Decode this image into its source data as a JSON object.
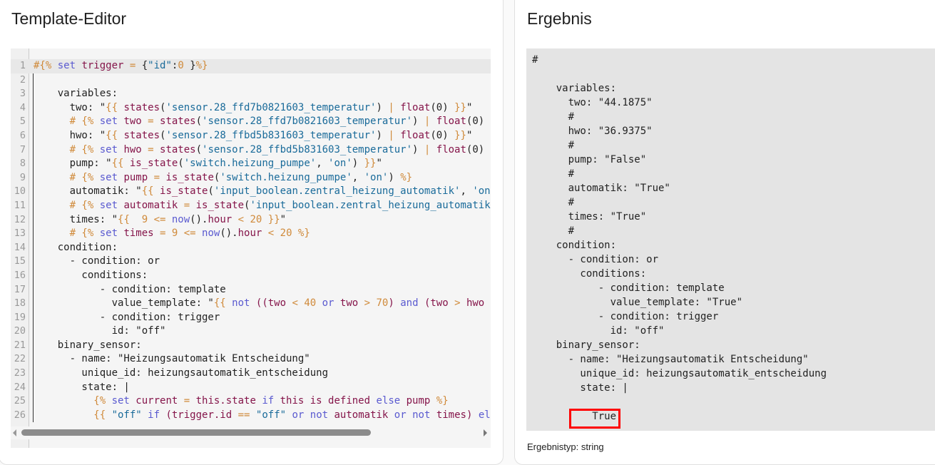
{
  "editor": {
    "title": "Template-Editor",
    "lines": [
      [
        [
          "o",
          "#{% "
        ],
        [
          "k",
          "set "
        ],
        [
          "v",
          "trigger "
        ],
        [
          "o",
          "= "
        ],
        [
          "d",
          "{"
        ],
        [
          "s",
          "\"id\""
        ],
        [
          "d",
          ":"
        ],
        [
          "o",
          "0 "
        ],
        [
          "d",
          "}"
        ],
        [
          "o",
          "%}"
        ]
      ],
      [],
      [
        [
          "d",
          "    variables:"
        ]
      ],
      [
        [
          "d",
          "      two: \""
        ],
        [
          "o",
          "{{ "
        ],
        [
          "v",
          "states"
        ],
        [
          "d",
          "("
        ],
        [
          "s",
          "'sensor.28_ffd7b0821603_temperatur'"
        ],
        [
          "d",
          ") "
        ],
        [
          "o",
          "| "
        ],
        [
          "v",
          "float"
        ],
        [
          "d",
          "(0) "
        ],
        [
          "o",
          "}}"
        ],
        [
          "d",
          "\""
        ]
      ],
      [
        [
          "o",
          "      # {% "
        ],
        [
          "k",
          "set "
        ],
        [
          "v",
          "two "
        ],
        [
          "o",
          "= "
        ],
        [
          "v",
          "states"
        ],
        [
          "d",
          "("
        ],
        [
          "s",
          "'sensor.28_ffd7b0821603_temperatur'"
        ],
        [
          "d",
          ") "
        ],
        [
          "o",
          "| "
        ],
        [
          "v",
          "float"
        ],
        [
          "d",
          "(0)"
        ]
      ],
      [
        [
          "d",
          "      hwo: \""
        ],
        [
          "o",
          "{{ "
        ],
        [
          "v",
          "states"
        ],
        [
          "d",
          "("
        ],
        [
          "s",
          "'sensor.28_ffbd5b831603_temperatur'"
        ],
        [
          "d",
          ") "
        ],
        [
          "o",
          "| "
        ],
        [
          "v",
          "float"
        ],
        [
          "d",
          "(0) "
        ],
        [
          "o",
          "}}"
        ],
        [
          "d",
          "\""
        ]
      ],
      [
        [
          "o",
          "      # {% "
        ],
        [
          "k",
          "set "
        ],
        [
          "v",
          "hwo "
        ],
        [
          "o",
          "= "
        ],
        [
          "v",
          "states"
        ],
        [
          "d",
          "("
        ],
        [
          "s",
          "'sensor.28_ffbd5b831603_temperatur'"
        ],
        [
          "d",
          ") "
        ],
        [
          "o",
          "| "
        ],
        [
          "v",
          "float"
        ],
        [
          "d",
          "(0)"
        ]
      ],
      [
        [
          "d",
          "      pump: \""
        ],
        [
          "o",
          "{{ "
        ],
        [
          "v",
          "is_state"
        ],
        [
          "d",
          "("
        ],
        [
          "s",
          "'switch.heizung_pumpe'"
        ],
        [
          "d",
          ", "
        ],
        [
          "s",
          "'on'"
        ],
        [
          "d",
          ") "
        ],
        [
          "o",
          "}}"
        ],
        [
          "d",
          "\""
        ]
      ],
      [
        [
          "o",
          "      # {% "
        ],
        [
          "k",
          "set "
        ],
        [
          "v",
          "pump "
        ],
        [
          "o",
          "= "
        ],
        [
          "v",
          "is_state"
        ],
        [
          "d",
          "("
        ],
        [
          "s",
          "'switch.heizung_pumpe'"
        ],
        [
          "d",
          ", "
        ],
        [
          "s",
          "'on'"
        ],
        [
          "d",
          ") "
        ],
        [
          "o",
          "%}"
        ]
      ],
      [
        [
          "d",
          "      automatik: \""
        ],
        [
          "o",
          "{{ "
        ],
        [
          "v",
          "is_state"
        ],
        [
          "d",
          "("
        ],
        [
          "s",
          "'input_boolean.zentral_heizung_automatik'"
        ],
        [
          "d",
          ", "
        ],
        [
          "s",
          "'on"
        ]
      ],
      [
        [
          "o",
          "      # {% "
        ],
        [
          "k",
          "set "
        ],
        [
          "v",
          "automatik "
        ],
        [
          "o",
          "= "
        ],
        [
          "v",
          "is_state"
        ],
        [
          "d",
          "("
        ],
        [
          "s",
          "'input_boolean.zentral_heizung_automatik"
        ]
      ],
      [
        [
          "d",
          "      times: \""
        ],
        [
          "o",
          "{{  9 <= "
        ],
        [
          "k",
          "now"
        ],
        [
          "d",
          "()."
        ],
        [
          "v",
          "hour "
        ],
        [
          "o",
          "< 20 }}"
        ],
        [
          "d",
          "\""
        ]
      ],
      [
        [
          "o",
          "      # {% "
        ],
        [
          "k",
          "set "
        ],
        [
          "v",
          "times "
        ],
        [
          "o",
          "= 9 <= "
        ],
        [
          "k",
          "now"
        ],
        [
          "d",
          "()."
        ],
        [
          "v",
          "hour "
        ],
        [
          "o",
          "< 20 %}"
        ]
      ],
      [
        [
          "d",
          "    condition:"
        ]
      ],
      [
        [
          "d",
          "      - condition: or"
        ]
      ],
      [
        [
          "d",
          "        conditions:"
        ]
      ],
      [
        [
          "d",
          "           - condition: template"
        ]
      ],
      [
        [
          "d",
          "             value_template: \""
        ],
        [
          "o",
          "{{ "
        ],
        [
          "k",
          "not "
        ],
        [
          "v",
          "(("
        ],
        [
          "v",
          "two "
        ],
        [
          "o",
          "< 40 "
        ],
        [
          "k",
          "or "
        ],
        [
          "v",
          "two "
        ],
        [
          "o",
          "> 70"
        ],
        [
          "v",
          ") "
        ],
        [
          "k",
          "and "
        ],
        [
          "v",
          "(two "
        ],
        [
          "o",
          "> "
        ],
        [
          "v",
          "hwo "
        ]
      ],
      [
        [
          "d",
          "           - condition: trigger"
        ]
      ],
      [
        [
          "d",
          "             id: \"off\""
        ]
      ],
      [
        [
          "d",
          "    binary_sensor:"
        ]
      ],
      [
        [
          "d",
          "      - name: \"Heizungsautomatik Entscheidung\""
        ]
      ],
      [
        [
          "d",
          "        unique_id: heizungsautomatik_entscheidung"
        ]
      ],
      [
        [
          "d",
          "        state: |"
        ]
      ],
      [
        [
          "o",
          "          {% "
        ],
        [
          "k",
          "set "
        ],
        [
          "v",
          "current "
        ],
        [
          "o",
          "= "
        ],
        [
          "v",
          "this.state "
        ],
        [
          "k",
          "if "
        ],
        [
          "v",
          "this is defined "
        ],
        [
          "k",
          "else "
        ],
        [
          "v",
          "pump "
        ],
        [
          "o",
          "%}"
        ]
      ],
      [
        [
          "o",
          "          {{ "
        ],
        [
          "s",
          "\"off\" "
        ],
        [
          "k",
          "if "
        ],
        [
          "v",
          "(trigger.id "
        ],
        [
          "o",
          "== "
        ],
        [
          "s",
          "\"off\" "
        ],
        [
          "k",
          "or not "
        ],
        [
          "v",
          "automatik "
        ],
        [
          "k",
          "or not "
        ],
        [
          "v",
          "times) "
        ],
        [
          "k",
          "el"
        ]
      ]
    ]
  },
  "result": {
    "title": "Ergebnis",
    "lines": [
      "#",
      "",
      "    variables:",
      "      two: \"44.1875\"",
      "      #",
      "      hwo: \"36.9375\"",
      "      #",
      "      pump: \"False\"",
      "      #",
      "      automatik: \"True\"",
      "      #",
      "      times: \"True\"",
      "      #",
      "    condition:",
      "      - condition: or",
      "        conditions:",
      "           - condition: template",
      "             value_template: \"True\"",
      "           - condition: trigger",
      "             id: \"off\"",
      "    binary_sensor:",
      "      - name: \"Heizungsautomatik Entscheidung\"",
      "        unique_id: heizungsautomatik_entscheidung",
      "        state: |",
      "",
      "          True"
    ],
    "type_label": "Ergebnistyp: string"
  }
}
